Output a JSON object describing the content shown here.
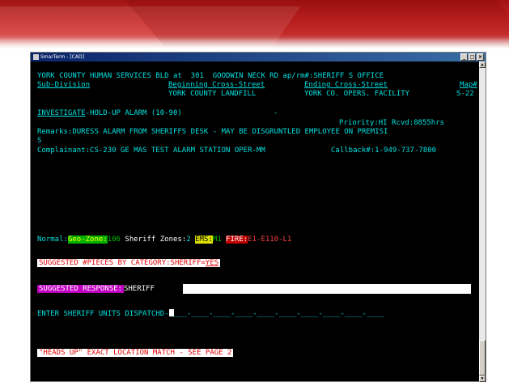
{
  "window": {
    "title": "SmarTerm - [CAD]",
    "buttons": [
      "_",
      "□",
      "×"
    ]
  },
  "terminal": {
    "address_line": "YORK COUNTY HUMAN SERVICES BLD at  301  GOODWIN NECK RD ap/rm#:SHERIFF S OFFICE",
    "subdivision_label": "Sub-Division",
    "beginning_cross_label": "Beginning Cross-Street",
    "ending_cross_label": "Ending Cross-Street",
    "map_label": "Map#",
    "beginning_cross_value": "YORK COUNTY LANDFILL",
    "ending_cross_value": "YORK CO. OPERS. FACILITY",
    "map_value": "S-22",
    "call_type_link": "INVESTIGATE",
    "call_type_rest": "-HOLD-UP ALARM (10-90)",
    "dash": "-",
    "priority_line": "Priority:HI Rcvd:0855hrs",
    "remarks_line1": "Remarks:DURESS ALARM FROM SHERIFFS DESK - MAY BE DISGRUNTLED EMPLOYEE ON PREMISI",
    "remarks_line2": "S",
    "complainant": "Complainant:CS-230 GE MAS TEST ALARM STATION OPER-MM",
    "callback": "Callback#:1-949-737-7800",
    "normal_label": "Normal:",
    "geo_zone_label": "Geo-Zone:",
    "geo_zone_value": "106",
    "sheriff_zones_label": "Sheriff Zones:",
    "sheriff_zones_value": "2",
    "ems_label": "EMS:",
    "ems_value": "M1",
    "fire_label": "FIRE:",
    "fire_value": "E1-E110-L1",
    "suggested_pieces_label": "SUGGESTED #PIECES BY CATEGORY:SHERIFF=",
    "suggested_pieces_value": "YES",
    "suggested_response_label": "SUGGESTED RESPONSE:",
    "suggested_response_value": "SHERIFF",
    "enter_units_label": "ENTER SHERIFF UNITS DISPATCHD-",
    "unit_slots": "___-____-____-____-____-____-____-____-____-____",
    "heads_up": "\"HEADS UP\" EXACT LOCATION MATCH - SEE PAGE 2"
  }
}
